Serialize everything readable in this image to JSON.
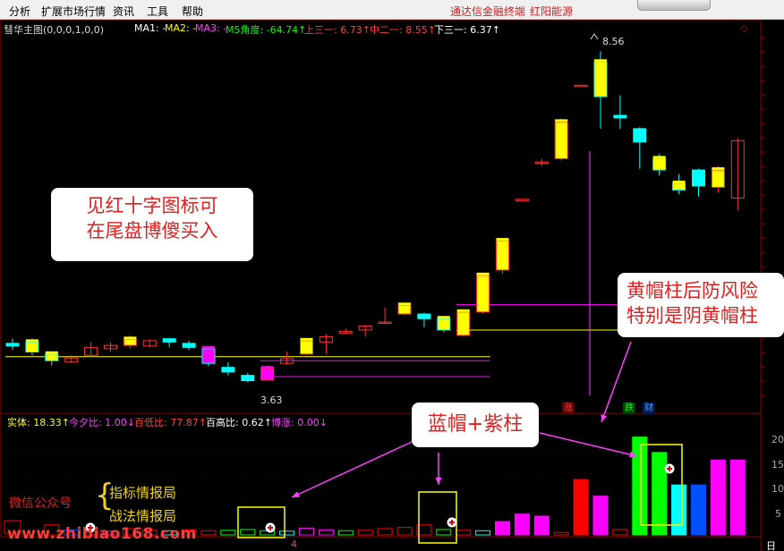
{
  "menu": {
    "items": [
      "分析",
      "扩展市场行情",
      "资讯",
      "工具",
      "帮助"
    ],
    "brand_left": "通达信金融终端",
    "brand_right": "红阳能源"
  },
  "main_indicator": {
    "name": "彗华主图(0,0,0,1,0,0)",
    "ma1": "MA1: -",
    "ma2": "MA2: -",
    "ma3": "MA3: -",
    "m5": "M5角度: -64.74↑",
    "up3": "上三一: 6.73↑",
    "mid2": "中二一: 8.55↑",
    "down3": "下三一: 6.37↑",
    "price_high": "8.56",
    "price_low": "3.63"
  },
  "sub_indicator": {
    "body": "实体: 18.33↑",
    "today_ratio": "今夕比: 1.00↓",
    "hundred_low": "百低比: 77.87↑",
    "hundred_high": "百高比: 0.62↑",
    "bozhang": "博涨: 0.00↓"
  },
  "tags": {
    "zhang": "涨",
    "die": "跌",
    "cai": "财"
  },
  "axis_numbers": [
    "20",
    "15",
    "10",
    "5"
  ],
  "annotations": {
    "red_cross": [
      "见红十字图标可",
      "在尾盘博傻买入"
    ],
    "yellow_cap": [
      "黄帽柱后防风险",
      "特别是阴黄帽柱"
    ],
    "blue_cap": "蓝帽+紫柱"
  },
  "promo": {
    "wechat_label": "微信公众号",
    "channel_1": "指标情报局",
    "channel_2": "战法情报局",
    "watermark": "www.zhibiao168.com"
  },
  "bottom_axis": {
    "marker": "4",
    "right_label": "日"
  },
  "colors": {
    "yang": "#ff3232",
    "yin": "#00ffff",
    "yellow": "#ffff00",
    "magenta": "#ff00ff",
    "green": "#00ff00",
    "blue": "#0050ff",
    "grey": "#808080"
  },
  "chart_data": {
    "type": "candlestick",
    "candles": [
      {
        "o": 4.18,
        "c": 4.14,
        "h": 4.25,
        "l": 4.08,
        "cap": ""
      },
      {
        "o": 4.2,
        "c": 4.05,
        "h": 4.25,
        "l": 4.0,
        "cap": "yellow"
      },
      {
        "o": 4.02,
        "c": 3.92,
        "h": 4.06,
        "l": 3.85,
        "cap": "yellow"
      },
      {
        "o": 3.9,
        "c": 3.96,
        "h": 4.0,
        "l": 3.88,
        "cap": "magenta"
      },
      {
        "o": 4.0,
        "c": 4.12,
        "h": 4.2,
        "l": 3.98,
        "cap": ""
      },
      {
        "o": 4.1,
        "c": 4.15,
        "h": 4.2,
        "l": 4.05,
        "cap": ""
      },
      {
        "o": 4.15,
        "c": 4.24,
        "h": 4.3,
        "l": 4.1,
        "cap": "yellow"
      },
      {
        "o": 4.14,
        "c": 4.22,
        "h": 4.24,
        "l": 4.12,
        "cap": ""
      },
      {
        "o": 4.25,
        "c": 4.2,
        "h": 4.26,
        "l": 4.12,
        "cap": ""
      },
      {
        "o": 4.18,
        "c": 4.12,
        "h": 4.22,
        "l": 4.08,
        "cap": ""
      },
      {
        "o": 4.1,
        "c": 3.88,
        "h": 4.12,
        "l": 3.84,
        "cap": "magenta"
      },
      {
        "o": 3.82,
        "c": 3.75,
        "h": 3.9,
        "l": 3.7,
        "cap": "yellow"
      },
      {
        "o": 3.7,
        "c": 3.62,
        "h": 3.74,
        "l": 3.6,
        "cap": "magenta"
      },
      {
        "o": 3.63,
        "c": 3.8,
        "h": 3.85,
        "l": 3.62,
        "cap": "magenta"
      },
      {
        "o": 3.88,
        "c": 3.95,
        "h": 4.06,
        "l": 3.86,
        "cap": ""
      },
      {
        "o": 4.02,
        "c": 4.22,
        "h": 4.25,
        "l": 4.0,
        "cap": "yellow"
      },
      {
        "o": 4.2,
        "c": 4.28,
        "h": 4.32,
        "l": 4.02,
        "cap": "yellow"
      },
      {
        "o": 4.33,
        "c": 4.36,
        "h": 4.4,
        "l": 4.32,
        "cap": ""
      },
      {
        "o": 4.38,
        "c": 4.44,
        "h": 4.45,
        "l": 4.28,
        "cap": ""
      },
      {
        "o": 4.5,
        "c": 4.5,
        "h": 4.72,
        "l": 4.48,
        "cap": ""
      },
      {
        "o": 4.62,
        "c": 4.75,
        "h": 4.8,
        "l": 4.6,
        "cap": "yellow"
      },
      {
        "o": 4.62,
        "c": 4.55,
        "h": 4.64,
        "l": 4.42,
        "cap": "yellow"
      },
      {
        "o": 4.55,
        "c": 4.38,
        "h": 4.58,
        "l": 4.35,
        "cap": "yellow"
      },
      {
        "o": 4.3,
        "c": 4.65,
        "h": 4.68,
        "l": 4.28,
        "cap": "yellow"
      },
      {
        "o": 4.65,
        "c": 5.2,
        "h": 5.22,
        "l": 4.62,
        "cap": "yellow"
      },
      {
        "o": 5.28,
        "c": 5.72,
        "h": 5.74,
        "l": 5.22,
        "cap": "yellow"
      },
      {
        "o": 6.34,
        "c": 6.34,
        "h": 6.34,
        "l": 6.34,
        "cap": ""
      },
      {
        "o": 6.9,
        "c": 6.9,
        "h": 6.95,
        "l": 6.84,
        "cap": ""
      },
      {
        "o": 6.95,
        "c": 7.5,
        "h": 7.55,
        "l": 6.92,
        "cap": "yellow"
      },
      {
        "o": 8.05,
        "c": 8.05,
        "h": 8.05,
        "l": 8.05,
        "cap": ""
      },
      {
        "o": 8.4,
        "c": 7.88,
        "h": 8.56,
        "l": 7.4,
        "cap": "yellow"
      },
      {
        "o": 7.6,
        "c": 7.56,
        "h": 7.9,
        "l": 7.4,
        "cap": "yellow"
      },
      {
        "o": 7.4,
        "c": 7.2,
        "h": 7.42,
        "l": 6.8,
        "cap": ""
      },
      {
        "o": 6.95,
        "c": 6.78,
        "h": 7.02,
        "l": 6.7,
        "cap": "yellow"
      },
      {
        "o": 6.58,
        "c": 6.48,
        "h": 6.72,
        "l": 6.42,
        "cap": "yellow"
      },
      {
        "o": 6.78,
        "c": 6.54,
        "h": 6.8,
        "l": 6.38,
        "cap": ""
      },
      {
        "o": 6.52,
        "c": 6.78,
        "h": 6.84,
        "l": 6.44,
        "cap": "yellow"
      },
      {
        "o": 6.36,
        "c": 7.22,
        "h": 7.26,
        "l": 6.18,
        "cap": ""
      }
    ],
    "price_range": [
      3.4,
      8.9
    ],
    "ref_lines": [
      {
        "start": 0,
        "end": 24,
        "value": 3.98,
        "color": "#ffff00"
      },
      {
        "start": 13,
        "end": 24,
        "value": 3.92,
        "color": "#ff00ff"
      },
      {
        "start": 13,
        "end": 24,
        "value": 3.68,
        "color": "#ff00ff"
      },
      {
        "start": 23,
        "end": 37,
        "value": 4.76,
        "color": "#ff00ff"
      },
      {
        "start": 23,
        "end": 37,
        "value": 4.38,
        "color": "#ffff00"
      }
    ],
    "sub_bars": [
      {
        "v": 2.4,
        "fill": "#ff0000"
      },
      {
        "v": 1.2,
        "fill": "#0050ff"
      },
      {
        "v": 1.4,
        "fill": "#ff0000"
      },
      {
        "v": 0.9,
        "fill": "#ff00ff"
      },
      {
        "v": 1.5,
        "fill": "#ff0000"
      },
      {
        "v": 1.1,
        "fill": "#ff0000"
      },
      {
        "v": 1.0,
        "fill": "#00ffff"
      },
      {
        "v": 1.2,
        "fill": "#ff0000"
      },
      {
        "v": 1.0,
        "fill": "#ff0000"
      },
      {
        "v": 1.1,
        "fill": "#00ff00"
      },
      {
        "v": 1.3,
        "fill": "#00ff00"
      },
      {
        "v": 1.0,
        "fill": "#00ff00"
      },
      {
        "v": 0.9,
        "fill": "#00ffff"
      },
      {
        "v": 1.6,
        "fill": "#ff00ff"
      },
      {
        "v": 1.2,
        "fill": "#ff00ff"
      },
      {
        "v": 1.0,
        "fill": "#00ff00"
      },
      {
        "v": 1.1,
        "fill": "#ff0000"
      },
      {
        "v": 1.5,
        "fill": "#ff0000"
      },
      {
        "v": 1.8,
        "fill": "#ff0000"
      },
      {
        "v": 2.4,
        "fill": "#ff0000"
      },
      {
        "v": 1.3,
        "fill": "#00ff00"
      },
      {
        "v": 1.1,
        "fill": "#ff0000"
      },
      {
        "v": 1.0,
        "fill": "#00ffff"
      },
      {
        "v": 3.2,
        "fill": "#ff00ff"
      },
      {
        "v": 5.0,
        "fill": "#ff00ff"
      },
      {
        "v": 4.5,
        "fill": "#ff00ff"
      },
      {
        "v": 0.6,
        "fill": "#ff0000"
      },
      {
        "v": 13.3,
        "fill": "#ff0000"
      },
      {
        "v": 9.3,
        "fill": "#ff00ff"
      },
      {
        "v": 1.3,
        "fill": "#ff0000"
      },
      {
        "v": 23.5,
        "fill": "#00ff00"
      },
      {
        "v": 19.8,
        "fill": "#00ff00"
      },
      {
        "v": 12.0,
        "fill": "#00ffff"
      },
      {
        "v": 12.0,
        "fill": "#0050ff"
      },
      {
        "v": 18.0,
        "fill": "#ff00ff"
      },
      {
        "v": 18.0,
        "fill": "#ff00ff"
      }
    ],
    "sub_range": [
      0,
      26
    ]
  }
}
